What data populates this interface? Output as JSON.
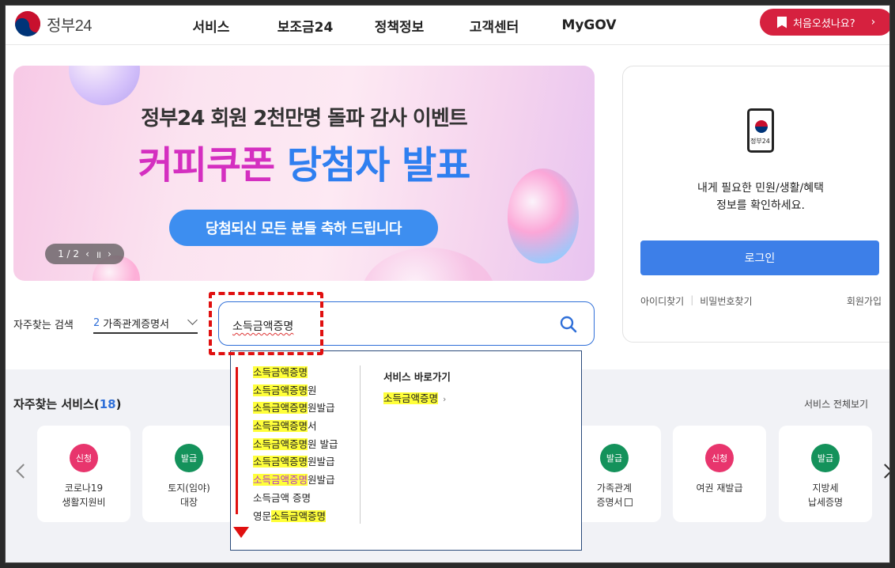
{
  "header": {
    "logo_text": "정부24",
    "nav": [
      "서비스",
      "보조금24",
      "정책정보",
      "고객센터",
      "MyGOV"
    ],
    "first_visit_label": "처음오셨나요?"
  },
  "banner": {
    "subtitle": "정부24 회원 2천만명 돌파 감사 이벤트",
    "title_part1": "커피쿠폰",
    "title_part2": "당첨자 발표",
    "pill": "당첨되신 모든 분들 축하 드립니다",
    "pager": "1 / 2"
  },
  "login": {
    "phone_label": "정부24",
    "message_line1": "내게 필요한 민원/생활/혜택",
    "message_line2": "정보를 확인하세요.",
    "button": "로그인",
    "find_id": "아이디찾기",
    "find_pw": "비밀번호찾기",
    "join": "회원가입"
  },
  "search": {
    "freq_label": "자주찾는 검색",
    "freq_rank": "2",
    "freq_value": "가족관계증명서",
    "value": "소득금액증명"
  },
  "autocomplete": {
    "items": [
      {
        "hl": "소득금액증명",
        "rest": ""
      },
      {
        "hl": "소득금액증명",
        "rest": "원"
      },
      {
        "hl": "소득금액증명",
        "rest": "원발급"
      },
      {
        "hl": "소득금액증명",
        "rest": "서"
      },
      {
        "hl": "소득금액증명",
        "rest": "원 발급"
      },
      {
        "hl": "소득금액증명",
        "rest": "원발급"
      },
      {
        "hl": "소득금액증명",
        "rest": "원발급"
      }
    ],
    "plain_item": "소득금액 증명",
    "last_prefix": "영문",
    "last_hl": "소득금액증명",
    "shortcut_title": "서비스 바로가기",
    "shortcut_item": "소득금액증명"
  },
  "services": {
    "title": "자주찾는 서비스",
    "count": "18",
    "view_all": "서비스 전체보기",
    "cards": [
      {
        "badge": "신청",
        "line1": "코로나19",
        "line2": "생활지원비",
        "type": "apply"
      },
      {
        "badge": "발급",
        "line1": "토지(임야)",
        "line2": "대장",
        "type": "issue"
      },
      {
        "badge": "발급",
        "line1": "가족관계",
        "line2": "증명서",
        "type": "issue"
      },
      {
        "badge": "신청",
        "line1": "여권 재발급",
        "line2": "",
        "type": "apply"
      },
      {
        "badge": "발급",
        "line1": "지방세",
        "line2": "납세증명",
        "type": "issue"
      }
    ]
  },
  "colors": {
    "brand_red": "#d6213f",
    "primary_blue": "#3d7fe8",
    "highlight": "#ffff3a",
    "annotation_red": "#e01010"
  }
}
